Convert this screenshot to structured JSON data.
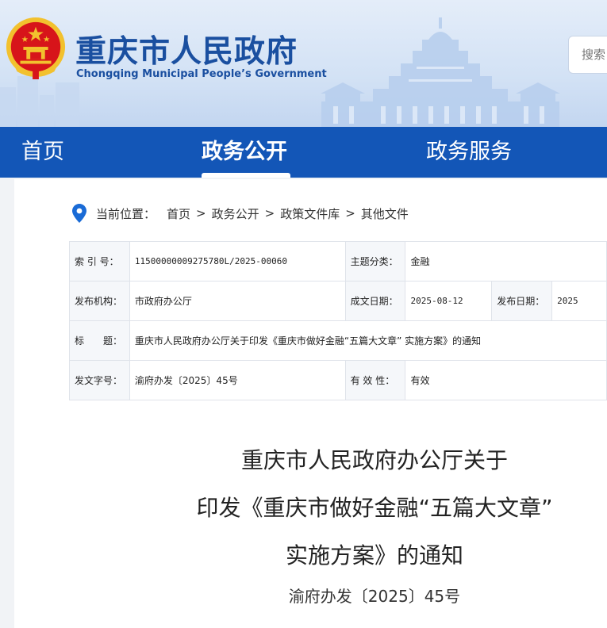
{
  "header": {
    "title": "重庆市人民政府",
    "subtitle": "Chongqing Municipal People’s Government",
    "search_placeholder": "搜索"
  },
  "nav": {
    "items": [
      {
        "label": "首页"
      },
      {
        "label": "政务公开",
        "active": true
      },
      {
        "label": "政务服务"
      }
    ]
  },
  "breadcrumb": {
    "prefix": "当前位置：",
    "separator": ">",
    "items": [
      "首页",
      "政务公开",
      "政策文件库",
      "其他文件"
    ]
  },
  "info": {
    "index_label": "索 引 号：",
    "index_value": "11500000009275780L/2025-00060",
    "topic_label": "主题分类：",
    "topic_value": "金融",
    "issuer_label": "发布机构：",
    "issuer_value": "市政府办公厅",
    "written_label": "成文日期：",
    "written_value": "2025-08-12",
    "published_label": "发布日期：",
    "published_value": "2025",
    "title_label": "标　　题：",
    "title_value": "重庆市人民政府办公厅关于印发《重庆市做好金融“五篇大文章” 实施方案》的通知",
    "docno_label": "发文字号：",
    "docno_value": "渝府办发〔2025〕45号",
    "validity_label": "有 效 性：",
    "validity_value": "有效"
  },
  "document": {
    "title_line1": "重庆市人民政府办公厅关于",
    "title_line2": "印发《重庆市做好金融“五篇大文章”",
    "title_line3": "实施方案》的通知",
    "number": "渝府办发〔2025〕45号"
  },
  "colors": {
    "brand_blue": "#1356b7",
    "title_blue": "#1a4fa0",
    "emblem_red": "#d7141a",
    "emblem_gold": "#f2c12e"
  },
  "icons": {
    "emblem": "national-emblem",
    "location": "location-pin-icon"
  }
}
